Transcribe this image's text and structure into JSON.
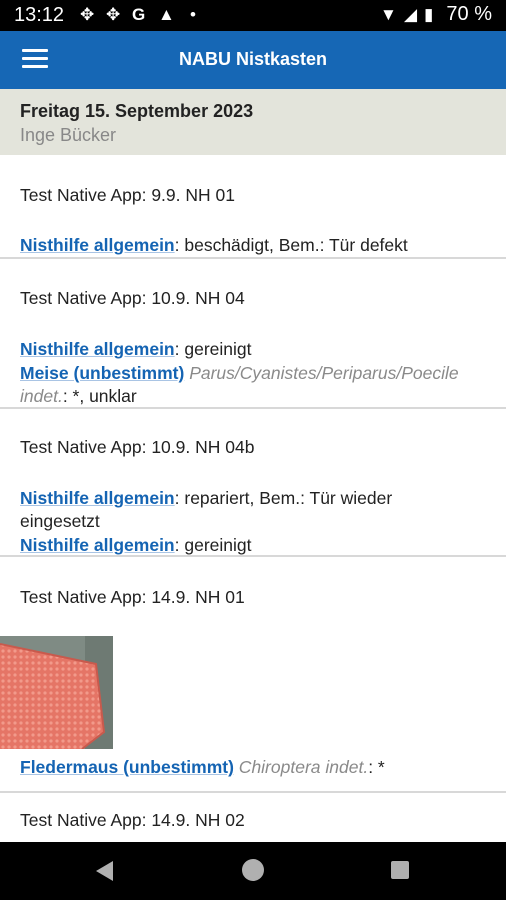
{
  "status": {
    "time": "13:12",
    "battery": "70 %"
  },
  "app": {
    "title": "NABU Nistkasten"
  },
  "day": {
    "date": "Freitag 15. September 2023",
    "user": "Inge Bücker"
  },
  "entries": [
    {
      "title": "Test Native App: 9.9. NH 01",
      "rows": [
        {
          "label": "Nisthilfe allgemein",
          "sep": ":",
          "text": "  beschädigt, Bem.:  Tür defekt"
        }
      ]
    },
    {
      "title": "Test Native App: 10.9. NH 04",
      "rows": [
        {
          "label": "Nisthilfe allgemein",
          "sep": ":",
          "text": "  gereinigt"
        },
        {
          "label": "Meise (unbestimmt)",
          "sci": " Parus/Cyanistes/Periparus/Poecile"
        },
        {
          "sci": "indet.",
          "text": ":  *, unklar"
        }
      ]
    },
    {
      "title": "Test Native App: 10.9. NH 04b",
      "rows": [
        {
          "label": "Nisthilfe allgemein",
          "sep": ":",
          "text": "  repariert, Bem.:  Tür wieder"
        },
        {
          "text": "eingesetzt"
        },
        {
          "label": "Nisthilfe allgemein",
          "sep": ":",
          "text": "  gereinigt"
        }
      ]
    },
    {
      "title": "Test Native App: 14.9. NH 01",
      "rows": [
        {
          "label": "Fledermaus (unbestimmt)",
          "sci": " Chiroptera indet.",
          "text": ":  *"
        }
      ]
    },
    {
      "title": "Test Native App: 14.9. NH 02",
      "rows": []
    }
  ]
}
